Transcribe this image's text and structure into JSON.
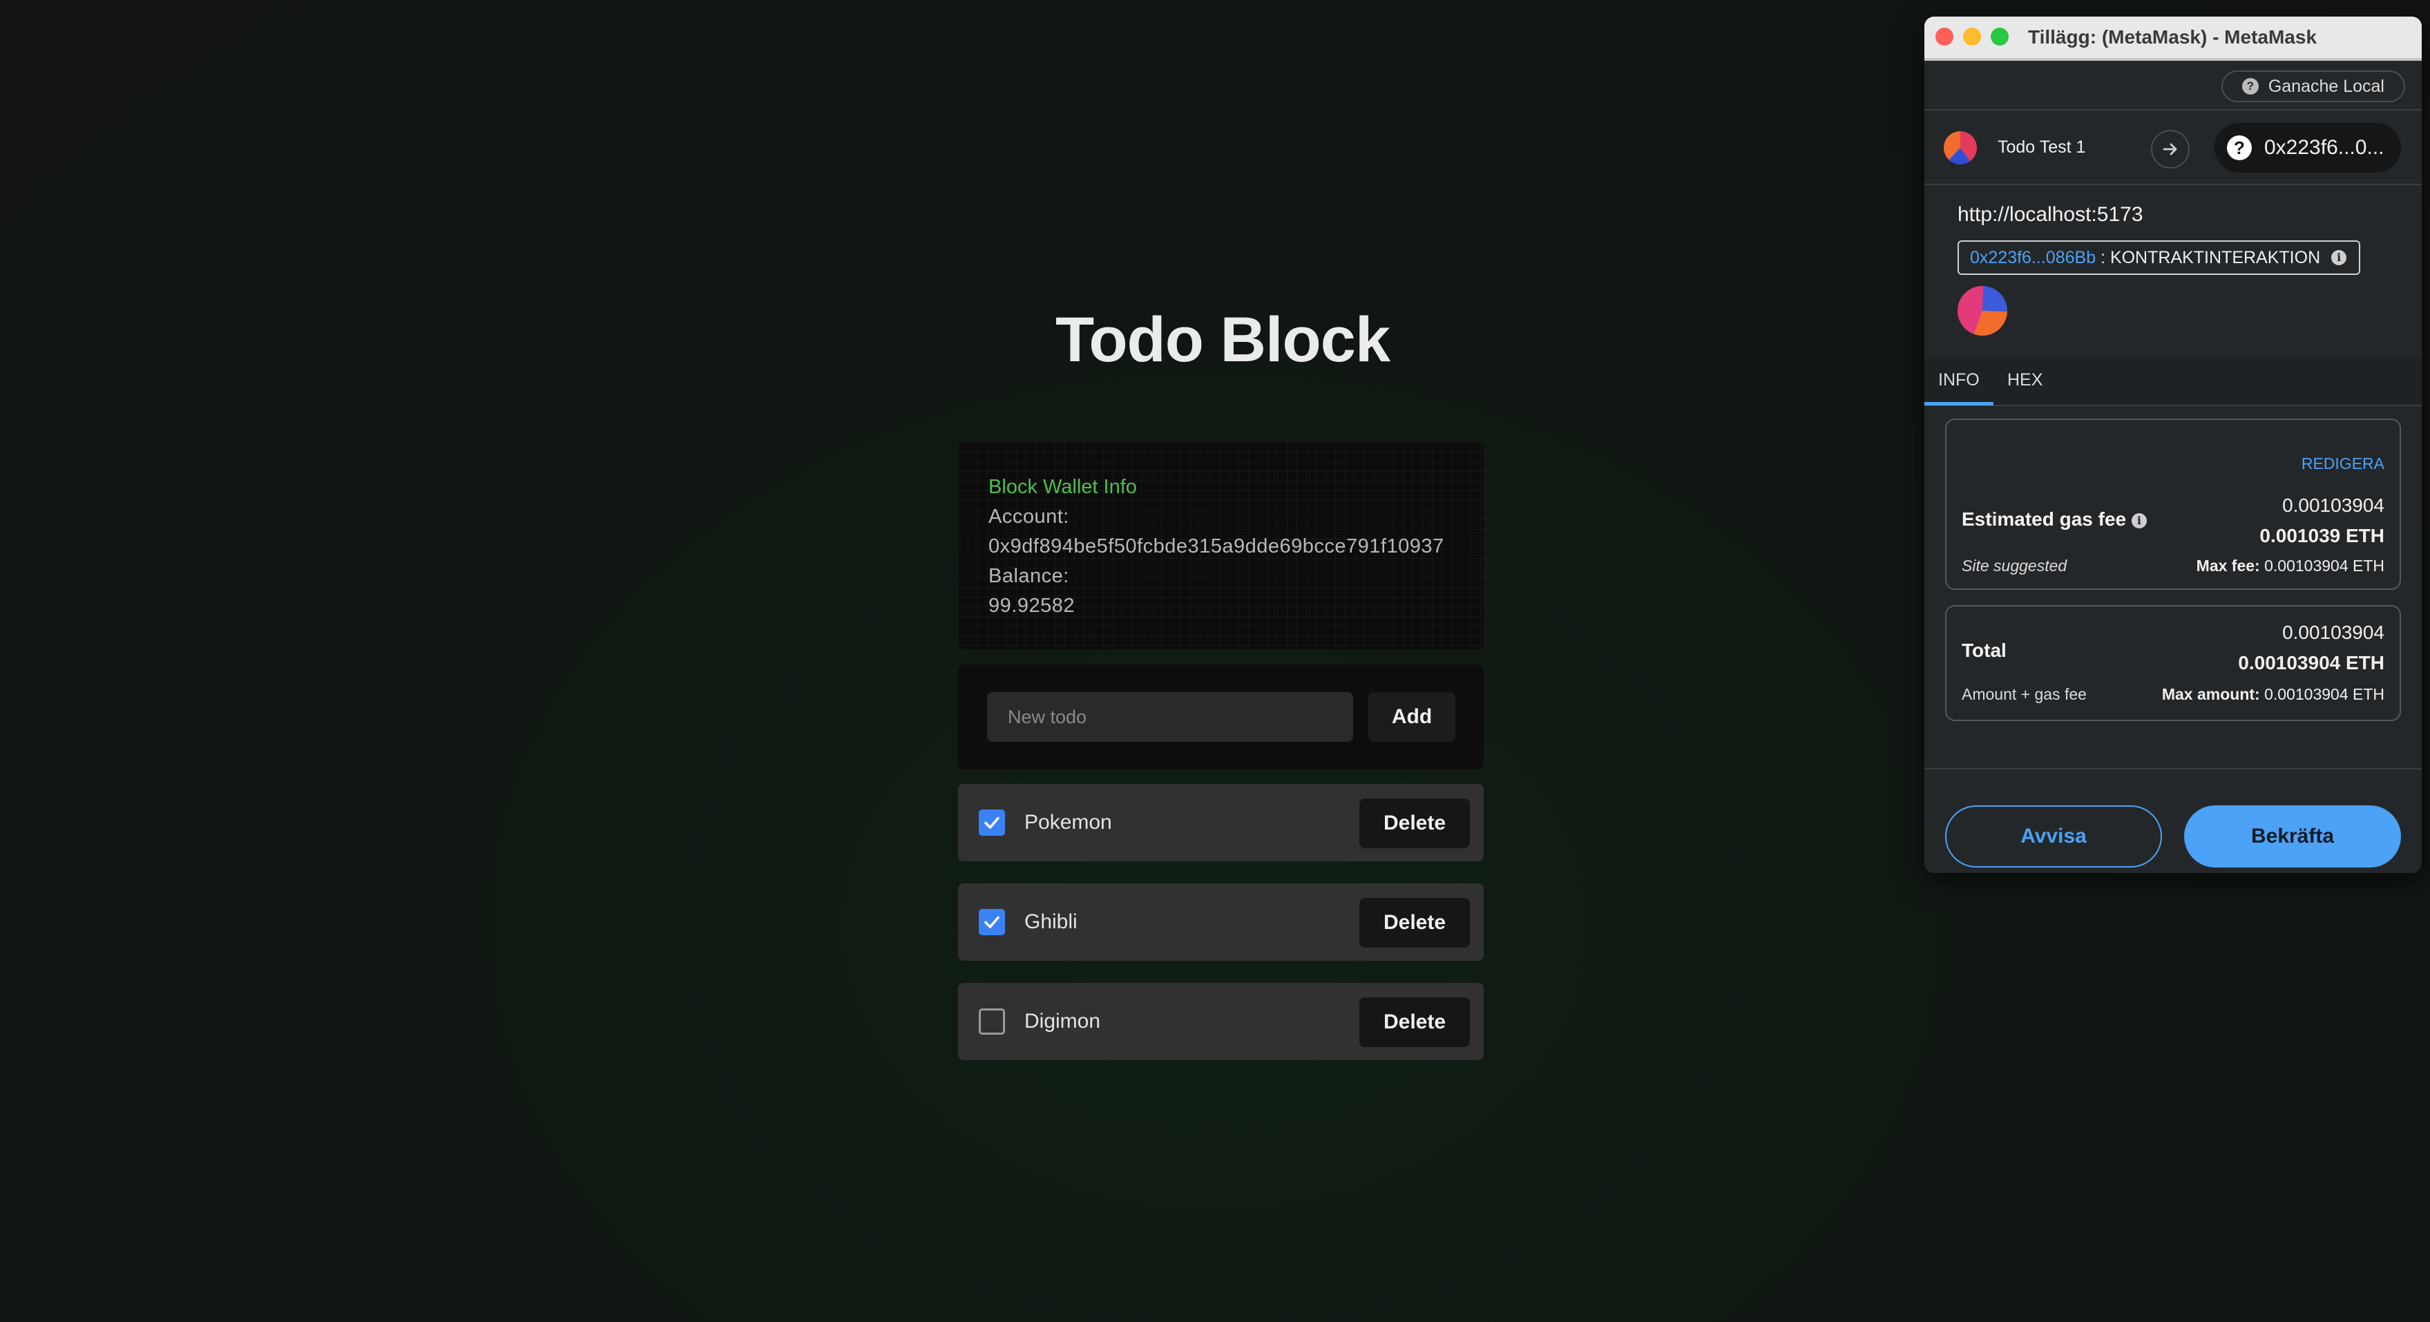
{
  "app": {
    "title": "Todo Block",
    "wallet": {
      "heading": "Block Wallet Info",
      "account_label": "Account:",
      "account_value": "0x9df894be5f50fcbde315a9dde69bcce791f10937",
      "balance_label": "Balance:",
      "balance_value": "99.92582"
    },
    "new_todo": {
      "placeholder": "New todo",
      "value": "",
      "add_label": "Add"
    },
    "todos": [
      {
        "label": "Pokemon",
        "checked": true,
        "delete_label": "Delete"
      },
      {
        "label": "Ghibli",
        "checked": true,
        "delete_label": "Delete"
      },
      {
        "label": "Digimon",
        "checked": false,
        "delete_label": "Delete"
      }
    ],
    "accent_color": "#3b82f6",
    "wallet_heading_color": "#4ec04a"
  },
  "metamask": {
    "window_title": "Tillägg: (MetaMask) - MetaMask",
    "network": {
      "icon": "question-icon",
      "label": "Ganache Local"
    },
    "from_account": "Todo Test 1",
    "to_address": "0x223f6...0...",
    "origin": "http://localhost:5173",
    "contract": {
      "address": "0x223f6...086Bb",
      "separator": " : ",
      "label": "KONTRAKTINTERAKTION"
    },
    "tabs": [
      {
        "label": "INFO",
        "active": true
      },
      {
        "label": "HEX",
        "active": false
      }
    ],
    "gas": {
      "edit_label": "REDIGERA",
      "title": "Estimated gas fee",
      "value": "0.00103904",
      "value_eth": "0.001039 ETH",
      "suggested": "Site suggested",
      "max_fee_label": "Max fee:",
      "max_fee_value": "0.00103904 ETH"
    },
    "total": {
      "title": "Total",
      "value": "0.00103904",
      "value_eth": "0.00103904 ETH",
      "sub": "Amount + gas fee",
      "max_amount_label": "Max amount:",
      "max_amount_value": "0.00103904 ETH"
    },
    "reject_label": "Avvisa",
    "confirm_label": "Bekräfta",
    "brand_color": "#4ba2f6"
  }
}
